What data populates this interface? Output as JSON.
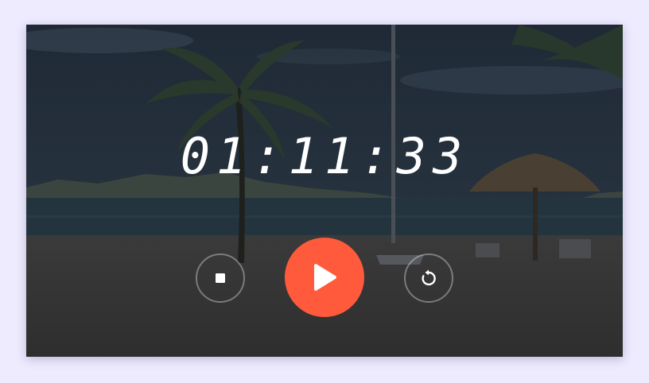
{
  "timer": {
    "display": "01:11:33"
  },
  "controls": {
    "stop_icon": "stop-icon",
    "play_icon": "play-icon",
    "reset_icon": "reset-icon"
  },
  "colors": {
    "background": "#eeebff",
    "accent": "#ff5a3c",
    "text": "#ffffff"
  }
}
